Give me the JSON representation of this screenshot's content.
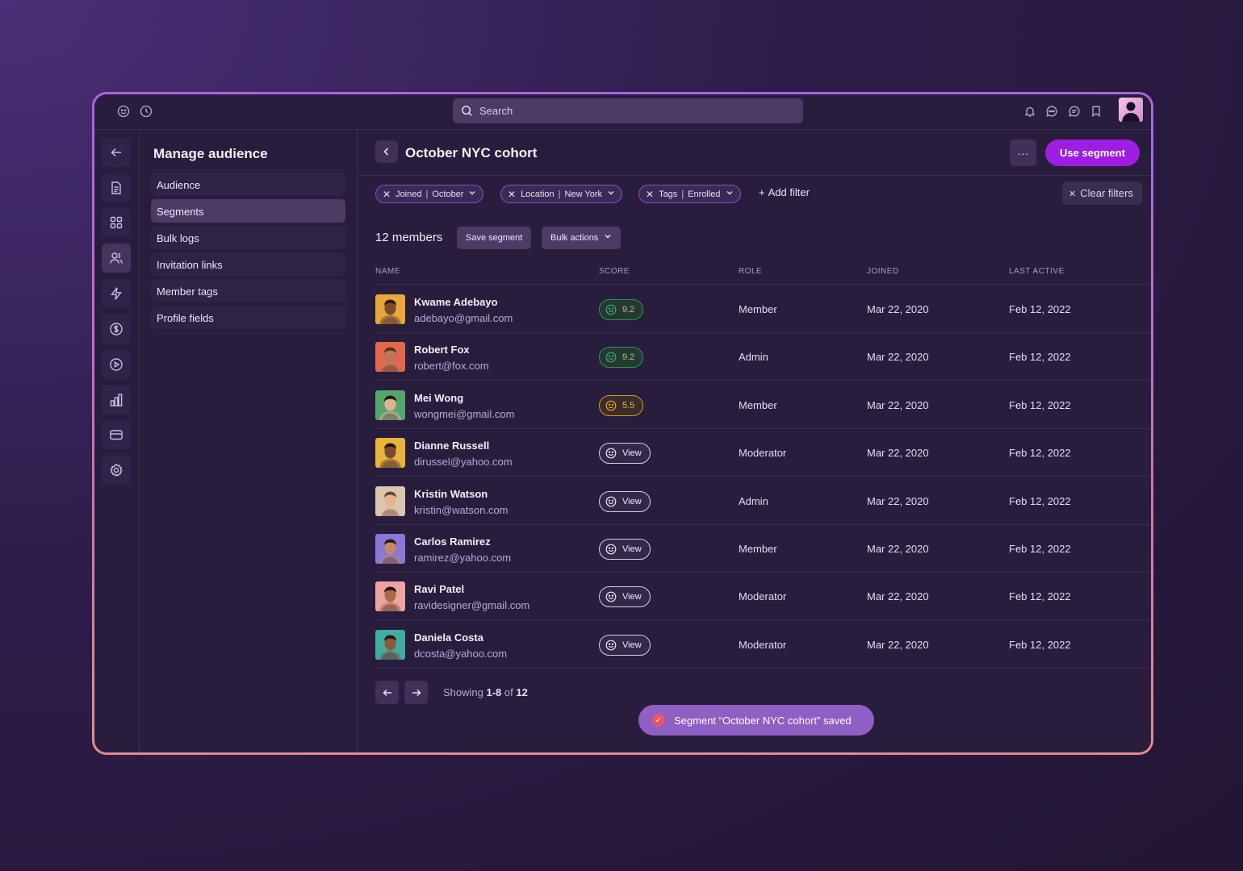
{
  "search": {
    "placeholder": "Search"
  },
  "nav": {
    "title": "Manage audience",
    "items": [
      {
        "label": "Audience"
      },
      {
        "label": "Segments"
      },
      {
        "label": "Bulk logs"
      },
      {
        "label": "Invitation links"
      },
      {
        "label": "Member tags"
      },
      {
        "label": "Profile fields"
      }
    ],
    "active_index": 1
  },
  "header": {
    "title": "October NYC cohort",
    "more_label": "···",
    "primary_label": "Use segment"
  },
  "filters": [
    {
      "key": "Joined",
      "value": "October"
    },
    {
      "key": "Location",
      "value": "New York"
    },
    {
      "key": "Tags",
      "value": "Enrolled"
    }
  ],
  "add_filter_label": "Add filter",
  "clear_filters_label": "Clear filters",
  "members_count_label": "12 members",
  "save_segment_label": "Save segment",
  "bulk_actions_label": "Bulk actions",
  "table": {
    "columns": [
      "NAME",
      "SCORE",
      "ROLE",
      "JOINED",
      "LAST ACTIVE"
    ],
    "rows": [
      {
        "name": "Kwame Adebayo",
        "email": "adebayo@gmail.com",
        "score": "9.2",
        "score_type": "green",
        "role": "Member",
        "joined": "Mar 22, 2020",
        "last_active": "Feb 12, 2022"
      },
      {
        "name": "Robert Fox",
        "email": "robert@fox.com",
        "score": "9.2",
        "score_type": "green",
        "role": "Admin",
        "joined": "Mar 22, 2020",
        "last_active": "Feb 12, 2022"
      },
      {
        "name": "Mei Wong",
        "email": "wongmei@gmail.com",
        "score": "5.5",
        "score_type": "yellow",
        "role": "Member",
        "joined": "Mar 22, 2020",
        "last_active": "Feb 12, 2022"
      },
      {
        "name": "Dianne Russell",
        "email": "dirussel@yahoo.com",
        "score": "View",
        "score_type": "view",
        "role": "Moderator",
        "joined": "Mar 22, 2020",
        "last_active": "Feb 12, 2022"
      },
      {
        "name": "Kristin Watson",
        "email": "kristin@watson.com",
        "score": "View",
        "score_type": "view",
        "role": "Admin",
        "joined": "Mar 22, 2020",
        "last_active": "Feb 12, 2022"
      },
      {
        "name": "Carlos Ramirez",
        "email": "ramirez@yahoo.com",
        "score": "View",
        "score_type": "view",
        "role": "Member",
        "joined": "Mar 22, 2020",
        "last_active": "Feb 12, 2022"
      },
      {
        "name": "Ravi Patel",
        "email": "ravidesigner@gmail.com",
        "score": "View",
        "score_type": "view",
        "role": "Moderator",
        "joined": "Mar 22, 2020",
        "last_active": "Feb 12, 2022"
      },
      {
        "name": "Daniela Costa",
        "email": "dcosta@yahoo.com",
        "score": "View",
        "score_type": "view",
        "role": "Moderator",
        "joined": "Mar 22, 2020",
        "last_active": "Feb 12, 2022"
      }
    ]
  },
  "pagination": {
    "prefix": "Showing",
    "range": "1-8",
    "of": "of",
    "total": "12"
  },
  "toast": {
    "message": "Segment “October NYC cohort” saved"
  },
  "colors": {
    "accent": "#9d1ee0",
    "good": "#1f9a55",
    "warn": "#d99818",
    "toast": "#8e5fc5"
  },
  "icons": {
    "topbar_left": [
      "emoji-icon",
      "clock-icon"
    ],
    "topbar_right": [
      "bell-icon",
      "chat-icon",
      "message-icon",
      "bookmark-icon"
    ],
    "rail": [
      "arrow-left-icon",
      "document-icon",
      "grid-icon",
      "users-icon",
      "bolt-icon",
      "dollar-icon",
      "play-icon",
      "bar-chart-icon",
      "card-icon",
      "gear-icon"
    ]
  }
}
